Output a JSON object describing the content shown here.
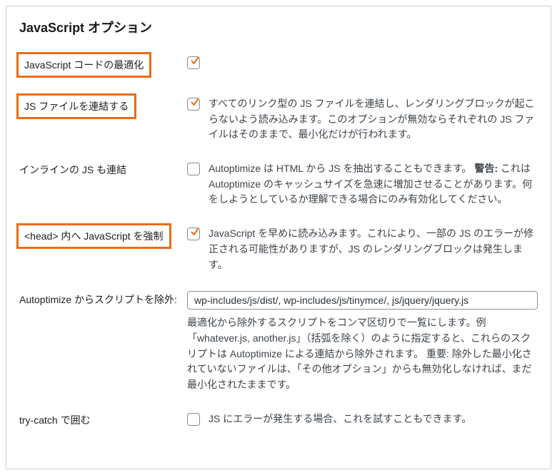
{
  "title": "JavaScript オプション",
  "rows": {
    "optimize": {
      "label": "JavaScript コードの最適化",
      "checked": true,
      "highlight": true
    },
    "aggregate": {
      "label": "JS ファイルを連結する",
      "checked": true,
      "highlight": true,
      "desc": "すべてのリンク型の JS ファイルを連結し、レンダリングブロックが起こらないよう読み込みます。このオプションが無効ならそれぞれの JS ファイルはそのままで、最小化だけが行われます。"
    },
    "inline": {
      "label": "インラインの JS も連結",
      "checked": false,
      "highlight": false,
      "desc_prefix": "Autoptimize は HTML から JS を抽出することもできます。",
      "desc_bold": "警告:",
      "desc_suffix": " これは Autoptimize のキャッシュサイズを急速に増加させることがあります。何をしようとしているか理解できる場合にのみ有効化してください。"
    },
    "forcehead": {
      "label": "<head> 内へ JavaScript を強制",
      "checked": true,
      "highlight": true,
      "desc": "JavaScript を早めに読み込みます。これにより、一部の JS のエラーが修正される可能性がありますが、JS のレンダリングブロックは発生します。"
    },
    "exclude": {
      "label": "Autoptimize からスクリプトを除外:",
      "value": "wp-includes/js/dist/, wp-includes/js/tinymce/, js/jquery/jquery.js",
      "desc": "最適化から除外するスクリプトをコンマ区切りで一覧にします。例「whatever.js, another.js」（括弧を除く）のように指定すると、これらのスクリプトは Autoptimize による連結から除外されます。 重要: 除外した最小化されていないファイルは、「その他オプション」からも無効化しなければ、まだ最小化されたままです。"
    },
    "trycatch": {
      "label": "try-catch で囲む",
      "checked": false,
      "highlight": false,
      "desc": "JS にエラーが発生する場合、これを試すこともできます。"
    }
  }
}
